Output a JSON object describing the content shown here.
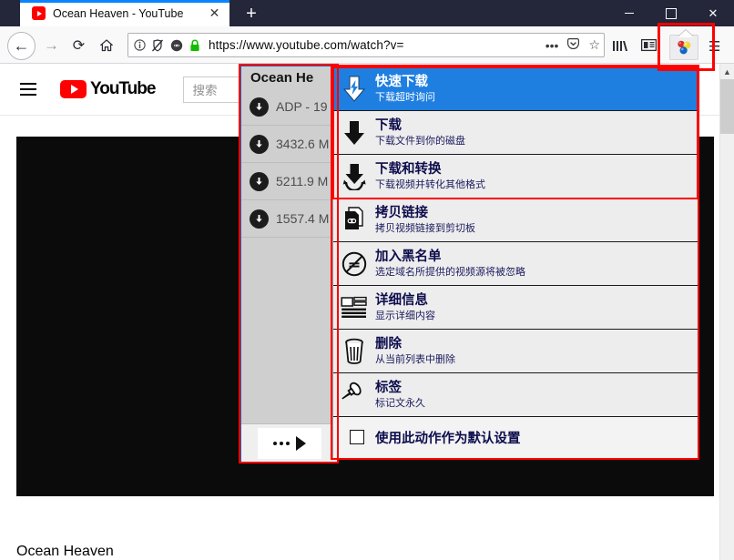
{
  "window": {
    "tab_title": "Ocean Heaven - YouTube",
    "tab_favicon": "youtube-icon",
    "close_tab_glyph": "✕",
    "new_tab_glyph": "+",
    "minimize_glyph": "—",
    "maximize_glyph": "□",
    "close_glyph": "✕"
  },
  "toolbar": {
    "back_glyph": "←",
    "forward_glyph": "→",
    "reload_glyph": "⟳",
    "home_glyph": "⌂",
    "identity_info_glyph": "ⓘ",
    "tracking_glyph": "🛇",
    "shield_glyph": "◕",
    "lock_glyph": "🔒",
    "url": "https://www.youtube.com/watch?v=",
    "url_dim_suffix": "",
    "page_actions_glyph": "•••",
    "pocket_glyph": "♡",
    "bookmark_glyph": "☆",
    "library_glyph": "❙❙❙\\",
    "reader_glyph": "▤",
    "extension_icon": "molecule-extension-icon",
    "app_menu_glyph": "☰"
  },
  "youtube": {
    "menu_glyph": "hamburger-icon",
    "logo_text": "YouTube",
    "search_placeholder": "搜索",
    "video_title": "Ocean Heaven"
  },
  "download_panel": {
    "header": "Ocean He",
    "rows": [
      {
        "icon": "download-circle-icon",
        "text": "ADP - 19"
      },
      {
        "icon": "download-circle-icon",
        "text": "3432.6 M"
      },
      {
        "icon": "download-circle-icon",
        "text": "5211.9 M"
      },
      {
        "icon": "download-circle-icon",
        "text": "1557.4 M"
      }
    ],
    "footer_more_glyph": "•••",
    "footer_play_glyph": "▶"
  },
  "context_menu": {
    "items": [
      {
        "icon": "fast-download-icon",
        "title": "快速下载",
        "subtitle": "下载超时询问",
        "selected": true
      },
      {
        "icon": "download-arrow-icon",
        "title": "下载",
        "subtitle": "下载文件到你的磁盘",
        "selected": false
      },
      {
        "icon": "download-convert-icon",
        "title": "下载和转换",
        "subtitle": "下载视频并转化其他格式",
        "selected": false
      },
      {
        "icon": "copy-link-icon",
        "title": "拷贝链接",
        "subtitle": "拷贝视频链接到剪切板",
        "selected": false
      },
      {
        "icon": "blacklist-icon",
        "title": "加入黑名单",
        "subtitle": "选定域名所提供的视频源将被忽略",
        "selected": false
      },
      {
        "icon": "details-icon",
        "title": "详细信息",
        "subtitle": "显示详细内容",
        "selected": false
      },
      {
        "icon": "trash-icon",
        "title": "删除",
        "subtitle": "从当前列表中删除",
        "selected": false
      },
      {
        "icon": "pin-tag-icon",
        "title": "标签",
        "subtitle": "标记文永久",
        "selected": false
      }
    ],
    "checkbox": {
      "label": "使用此动作作为默认设置",
      "checked": false
    }
  },
  "colors": {
    "titlebar": "#24263a",
    "tab_accent": "#0a84ff",
    "menu_selected": "#1f7fe0",
    "highlight_red": "#ff0000",
    "youtube_red": "#ff0000"
  }
}
